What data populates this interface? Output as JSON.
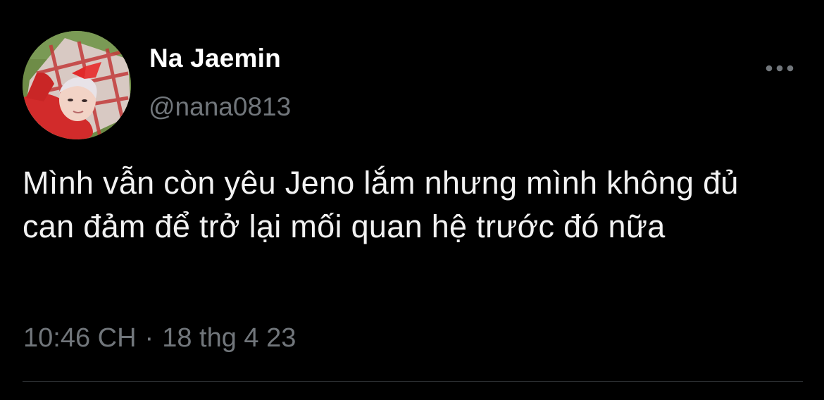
{
  "tweet": {
    "author": {
      "display_name": "Na Jaemin",
      "handle": "@nana0813",
      "avatar": "profile-photo"
    },
    "text": "Mình vẫn còn yêu Jeno lắm nhưng mình không đủ can đảm để trở lại mối quan hệ trước đó nữa",
    "time": "10:46 CH",
    "separator": "·",
    "date": "18 thg 4 23",
    "more_icon": "more-horizontal-icon"
  },
  "colors": {
    "background": "#000000",
    "primary_text": "#ffffff",
    "secondary_text": "#71767b",
    "divider": "#2f3336"
  }
}
